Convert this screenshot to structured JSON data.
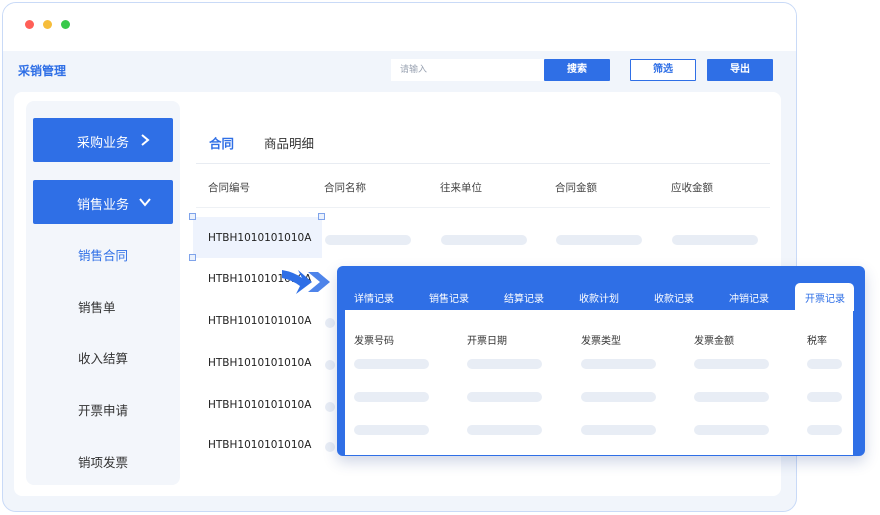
{
  "window": {
    "controls": [
      "close",
      "minimize",
      "maximize"
    ]
  },
  "header": {
    "title": "采销管理",
    "search_placeholder": "请输入",
    "search_label": "搜索",
    "filter_label": "筛选",
    "export_label": "导出"
  },
  "sidebar": {
    "purchase_label": "采购业务",
    "sales_label": "销售业务",
    "items": [
      {
        "label": "销售合同",
        "active": true
      },
      {
        "label": "销售单"
      },
      {
        "label": "收入结算"
      },
      {
        "label": "开票申请"
      },
      {
        "label": "销项发票"
      }
    ]
  },
  "main": {
    "tabs": [
      {
        "label": "合同",
        "active": true
      },
      {
        "label": "商品明细"
      }
    ],
    "columns": [
      "合同编号",
      "合同名称",
      "往来单位",
      "合同金额",
      "应收金额"
    ],
    "rows": [
      {
        "code": "HTBH1010101010A"
      },
      {
        "code": "HTBH1010101010A"
      },
      {
        "code": "HTBH1010101010A"
      },
      {
        "code": "HTBH1010101010A"
      },
      {
        "code": "HTBH1010101010A"
      },
      {
        "code": "HTBH1010101010A"
      }
    ]
  },
  "popup": {
    "tabs": [
      {
        "label": "详情记录"
      },
      {
        "label": "销售记录"
      },
      {
        "label": "结算记录"
      },
      {
        "label": "收款计划"
      },
      {
        "label": "收款记录"
      },
      {
        "label": "冲销记录"
      },
      {
        "label": "开票记录",
        "active": true
      }
    ],
    "columns": [
      "发票号码",
      "开票日期",
      "发票类型",
      "发票金额",
      "税率"
    ]
  },
  "colors": {
    "accent": "#2f6fe6",
    "skeleton": "#e8edf5",
    "frame": "#c9daf7"
  }
}
